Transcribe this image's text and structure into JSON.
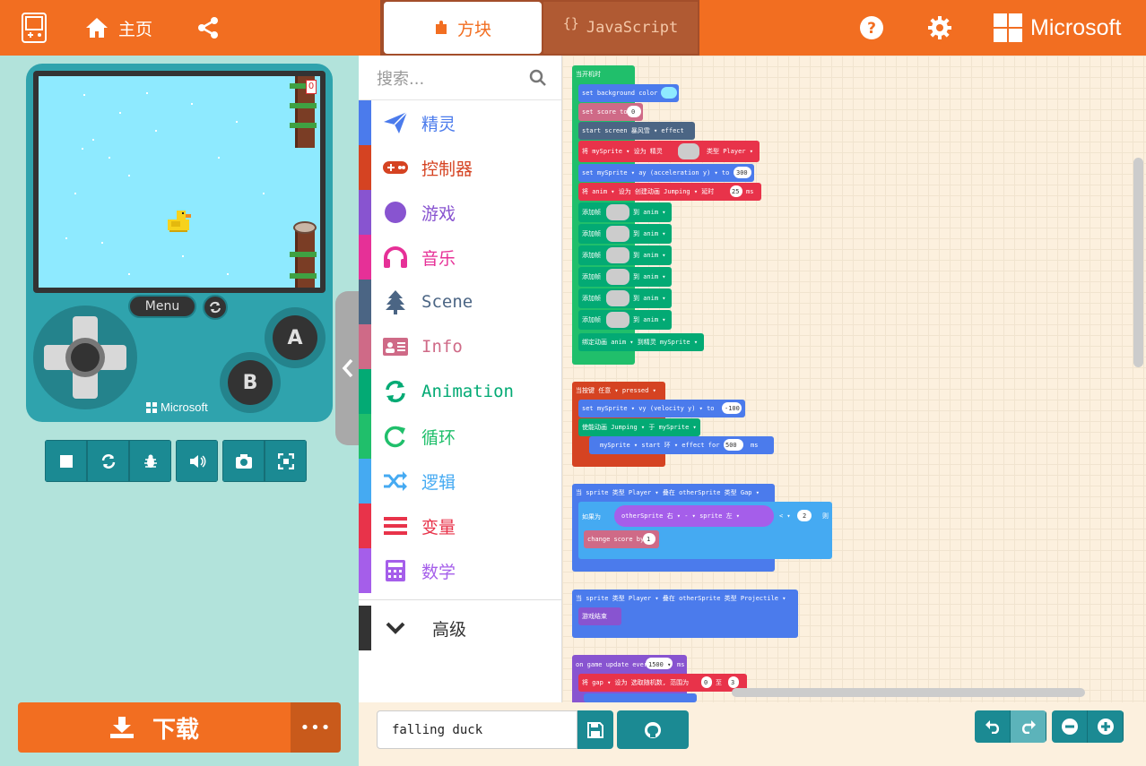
{
  "header": {
    "home_label": "主页",
    "tab_blocks": "方块",
    "tab_js_brace": "{}",
    "tab_js": "JavaScript",
    "brand": "Microsoft"
  },
  "simulator": {
    "score": "0",
    "menu_label": "Menu",
    "a_label": "A",
    "b_label": "B",
    "device_brand": "Microsoft"
  },
  "download": {
    "label": "下载",
    "more": "•••"
  },
  "toolbox": {
    "search_placeholder": "搜索...",
    "categories": [
      {
        "label": "精灵",
        "color": "#4b7bec",
        "icon": "paper-plane-icon"
      },
      {
        "label": "控制器",
        "color": "#d54322",
        "icon": "gamepad-icon"
      },
      {
        "label": "游戏",
        "color": "#8854d0",
        "icon": "circle-icon"
      },
      {
        "label": "音乐",
        "color": "#e63097",
        "icon": "headphones-icon"
      },
      {
        "label": "Scene",
        "color": "#4b6584",
        "icon": "tree-icon"
      },
      {
        "label": "Info",
        "color": "#cf6a87",
        "icon": "id-card-icon"
      },
      {
        "label": "Animation",
        "color": "#03aa74",
        "icon": "refresh-icon"
      },
      {
        "label": "循环",
        "color": "#20bf6b",
        "icon": "loop-icon"
      },
      {
        "label": "逻辑",
        "color": "#45aaf2",
        "icon": "shuffle-icon"
      },
      {
        "label": "变量",
        "color": "#e8334a",
        "icon": "list-icon"
      },
      {
        "label": "数学",
        "color": "#a55eea",
        "icon": "calculator-icon"
      }
    ],
    "advanced": {
      "label": "高级",
      "color": "#333333",
      "icon": "chevron-down-icon"
    }
  },
  "blocks": {
    "on_start": "当开机时",
    "set_bg": "set background color to",
    "set_score": "set score to",
    "score_val": "0",
    "start_screen": "start screen 暴风雪 ▾  effect",
    "sprite_row": "将  mySprite ▾  设为  精灵",
    "sprite_kind": "类型  Player ▾",
    "set_ay": "set  mySprite ▾  ay (acceleration y) ▾  to",
    "ay_val": "300",
    "anim_row": "将  anim ▾  设为  创建动画  Jumping ▾  延时",
    "anim_ms_val": "25",
    "anim_ms": "ms",
    "add_frame": "添加帧",
    "add_frame_to": "到  anim ▾",
    "attach_anim": "绑定动画  anim ▾  到精灵  mySprite ▾",
    "on_button": "当按键  任意 ▾  pressed ▾",
    "set_vy": "set  mySprite ▾  vy (velocity y) ▾  to",
    "vy_val": "-100",
    "activate_anim": "使能动画  Jumping ▾  于  mySprite ▾",
    "start_effect": "mySprite ▾  start  环 ▾  effect for",
    "effect_ms_val": "500",
    "effect_ms": "ms",
    "overlap_gap": "当  sprite  类型  Player ▾  叠在  otherSprite  类型  Gap ▾",
    "if_label": "如果为",
    "compare": "otherSprite  右 ▾  - ▾  sprite  左 ▾",
    "compare_op": "< ▾",
    "compare_val": "2",
    "then_label": "则",
    "change_score": "change score by",
    "change_val": "1",
    "overlap_proj": "当  sprite  类型  Player ▾  叠在  otherSprite  类型  Projectile ▾",
    "game_over": "游戏结束",
    "on_update": "on game update every",
    "update_val": "1500 ▾",
    "update_ms": "ms",
    "set_gap": "将  gap ▾  设为  选取随机数, 范围为",
    "gap_from": "0",
    "gap_to_label": "至",
    "gap_to": "3"
  },
  "bottom": {
    "project_name": "falling duck"
  }
}
